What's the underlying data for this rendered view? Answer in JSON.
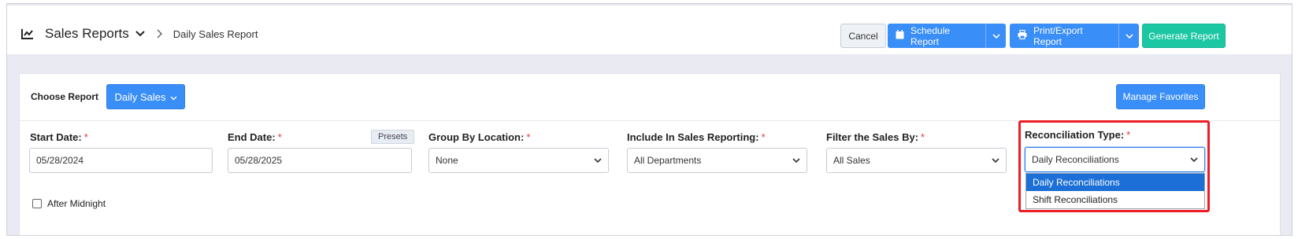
{
  "header": {
    "title": "Sales Reports",
    "separator": ">",
    "current": "Daily Sales Report",
    "cancel_label": "Cancel",
    "schedule_label": "Schedule Report",
    "print_label": "Print/Export Report",
    "generate_label": "Generate Report"
  },
  "report": {
    "choose_label": "Choose Report",
    "selected_report": "Daily Sales",
    "manage_label": "Manage Favorites"
  },
  "fields": {
    "required_mark": "*",
    "start_date_label": "Start Date:",
    "start_date_value": "05/28/2024",
    "end_date_label": "End Date:",
    "end_date_value": "05/28/2025",
    "presets_label": "Presets",
    "group_by_label": "Group By Location:",
    "group_by_value": "None",
    "include_label": "Include In Sales Reporting:",
    "include_value": "All Departments",
    "filter_label": "Filter the Sales By:",
    "filter_value": "All Sales",
    "recon_label": "Reconciliation Type:",
    "recon_value": "Daily Reconciliations",
    "recon_options": [
      "Daily Reconciliations",
      "Shift Reconciliations"
    ]
  },
  "after_midnight_label": "After Midnight",
  "colors": {
    "primary": "#3a8ef7",
    "teal": "#1cc7a4",
    "highlight": "#ee1c25",
    "selected_option": "#1b6fd6"
  },
  "icons": [
    "chart-line-icon",
    "chevron-down-icon",
    "chevron-right-icon",
    "calendar-icon",
    "printer-icon",
    "caret-down-icon"
  ]
}
